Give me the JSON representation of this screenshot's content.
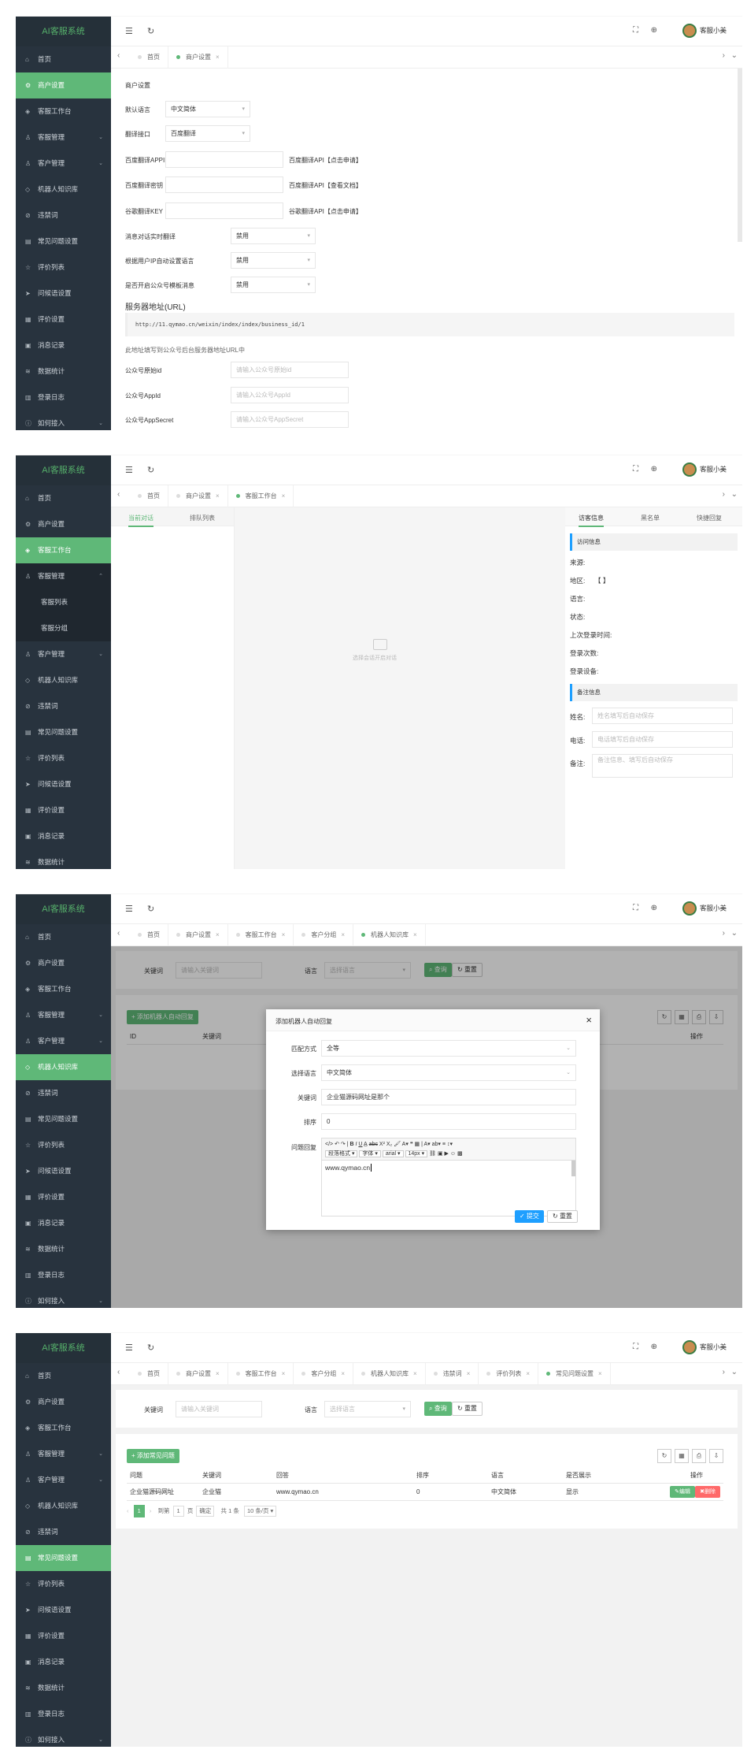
{
  "app": {
    "logo": "AI客服系统",
    "user": "客服小美"
  },
  "menu": {
    "home": "首页",
    "merchant": "商户设置",
    "workbench": "客服工作台",
    "staff": "客服管理",
    "customer": "客户管理",
    "kb": "机器人知识库",
    "banned": "违禁词",
    "faq": "常见问题设置",
    "review_list": "评价列表",
    "greeting": "问候语设置",
    "review_set": "评价设置",
    "msgs": "消息记录",
    "stats": "数据统计",
    "login_log": "登录日志",
    "how": "如何接入",
    "staff_list": "客服列表",
    "staff_group": "客服分组"
  },
  "tabs": {
    "home": "首页",
    "merchant": "商户设置",
    "workbench": "客服工作台",
    "customer_group": "客户分组",
    "kb": "机器人知识库",
    "banned": "违禁词",
    "review_list": "评价列表",
    "faq": "常见问题设置"
  },
  "s1": {
    "section": "商户设置",
    "default_lang_label": "默认语言",
    "default_lang": "中文简体",
    "trans_label": "翻译接口",
    "trans": "百度翻译",
    "appid_label": "百度翻译APPID",
    "appid_help": "百度翻译API【点击申请】",
    "secret_label": "百度翻译密钥",
    "secret_help": "百度翻译API【查看文档】",
    "google_label": "谷歌翻译KEY",
    "google_help": "谷歌翻译API【点击申请】",
    "realtime_label": "消息对话实时翻译",
    "realtime": "禁用",
    "ip_label": "根据用户IP自动设置语言",
    "ip": "禁用",
    "mp_label": "是否开启公众号模板消息",
    "mp": "禁用",
    "server_title": "服务器地址(URL)",
    "server_url": "http://11.qymao.cn/weixin/index/index/business_id/1",
    "server_note": "此地址填写到公众号后台服务器地址URL中",
    "orig_label": "公众号原始id",
    "orig_ph": "请输入公众号原始id",
    "appid2_label": "公众号AppId",
    "appid2_ph": "请输入公众号AppId",
    "appsec_label": "公众号AppSecret",
    "appsec_ph": "请输入公众号AppSecret"
  },
  "s2": {
    "tab_current": "当前对话",
    "tab_queue": "排队列表",
    "empty": "选择会话开启对话",
    "rtab_info": "访客信息",
    "rtab_list": "黑名单",
    "rtab_quick": "快捷回复",
    "visit_title": "访问信息",
    "from": "来源:",
    "region": "地区:",
    "region_val": "【 】",
    "lang": "语言:",
    "status": "状态:",
    "last_login": "上次登录时间:",
    "login_count": "登录次数:",
    "device": "登录设备:",
    "note_title": "备注信息",
    "name_label": "姓名:",
    "name_ph": "姓名填写后自动保存",
    "phone_label": "电话:",
    "phone_ph": "电话填写后自动保存",
    "remark_label": "备注:",
    "remark_ph": "备注信息、填写后自动保存"
  },
  "s3": {
    "kw_label": "关键词",
    "kw_ph": "请输入关键词",
    "lang_label": "语言",
    "lang_ph": "选择语言",
    "search": "查询",
    "reset": "重置",
    "add": "添加机器人自动回复",
    "col_id": "ID",
    "col_kw": "关键词",
    "col_ke": "式",
    "col_op": "操作",
    "modal_title": "添加机器人自动回复",
    "match_label": "匹配方式",
    "match": "全等",
    "mlang_label": "选择语言",
    "mlang": "中文简体",
    "mkw_label": "关键词",
    "mkw": "企业猫源码网址是那个",
    "sort_label": "排序",
    "sort": "0",
    "ans_label": "问题回复",
    "para": "段落格式",
    "font_sel": "字体",
    "font": "arial",
    "size": "14px",
    "content": "www.qymao.cn",
    "submit": "提交",
    "mreset": "重置"
  },
  "s4": {
    "kw_label": "关键词",
    "kw_ph": "请输入关键词",
    "lang_label": "语言",
    "lang_ph": "选择语言",
    "search": "查询",
    "reset": "重置",
    "add": "添加常见问题",
    "cols": [
      "问题",
      "关键词",
      "回答",
      "排序",
      "语言",
      "是否展示",
      "操作"
    ],
    "row": [
      "企业猫源码网址",
      "企业猫",
      "www.qymao.cn",
      "0",
      "中文简体",
      "显示"
    ],
    "edit": "编辑",
    "del": "删除",
    "pg_goto": "到第",
    "pg_page": "1",
    "pg_unit": "页",
    "pg_ok": "确定",
    "pg_total": "共 1 条",
    "pg_size": "10 条/页",
    "pg_cur": "1"
  }
}
